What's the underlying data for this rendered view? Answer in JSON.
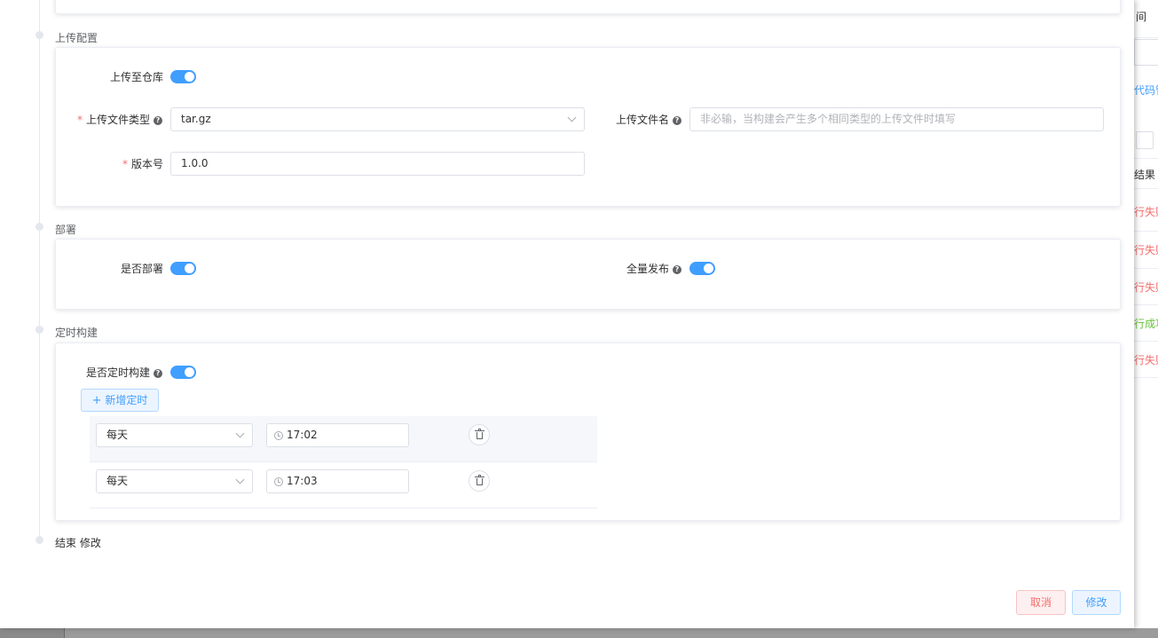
{
  "background": {
    "peek_texts": [
      {
        "text": "间",
        "color": "#303133"
      },
      {
        "text": "代码管",
        "color": "#409eff"
      },
      {
        "text": "结果",
        "color": "#303133"
      },
      {
        "text": "行失败",
        "color": "#f56c6c"
      },
      {
        "text": "行失败",
        "color": "#f56c6c"
      },
      {
        "text": "行失败",
        "color": "#f56c6c"
      },
      {
        "text": "行成功",
        "color": "#67c23a"
      },
      {
        "text": "行失败",
        "color": "#f56c6c"
      }
    ]
  },
  "sections": {
    "upload": {
      "title": "上传配置",
      "to_repo_label": "上传至仓库",
      "to_repo_on": true,
      "file_type_label": "上传文件类型",
      "file_type_value": "tar.gz",
      "file_name_label": "上传文件名",
      "file_name_placeholder": "非必输，当构建会产生多个相同类型的上传文件时填写",
      "version_label": "版本号",
      "version_value": "1.0.0"
    },
    "deploy": {
      "title": "部署",
      "deploy_label": "是否部署",
      "deploy_on": true,
      "full_release_label": "全量发布",
      "full_release_on": true
    },
    "schedule": {
      "title": "定时构建",
      "enable_label": "是否定时构建",
      "enable_on": true,
      "add_button": "新增定时",
      "rows": [
        {
          "frequency": "每天",
          "time": "17:02"
        },
        {
          "frequency": "每天",
          "time": "17:03"
        }
      ]
    },
    "end": {
      "title": "结束 修改"
    }
  },
  "footer": {
    "cancel_label": "取消",
    "submit_label": "修改"
  },
  "colors": {
    "primary": "#409eff",
    "danger": "#f56c6c",
    "success": "#67c23a"
  }
}
